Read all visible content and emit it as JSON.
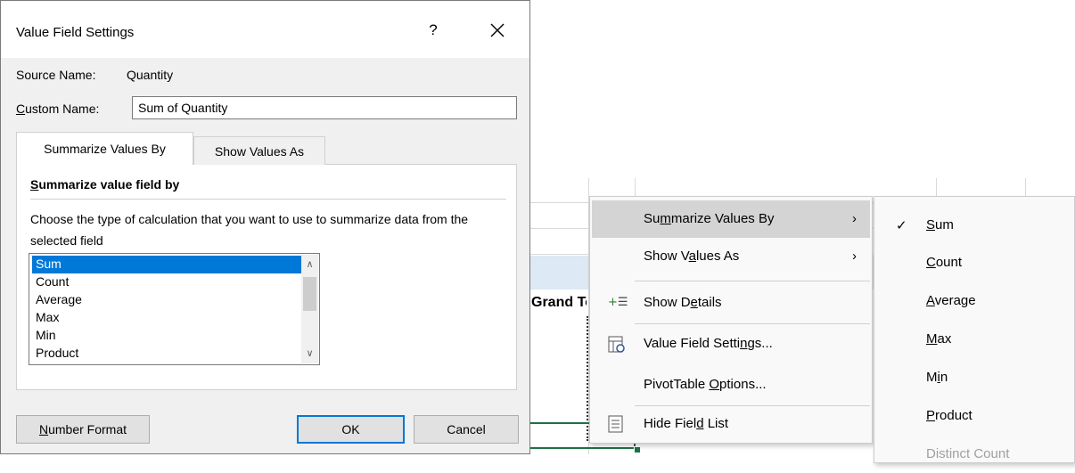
{
  "dialog": {
    "title": "Value Field Settings",
    "help_label": "?",
    "source_name_label": "Source Name:",
    "source_name_value": "Quantity",
    "custom_name_label_first": "C",
    "custom_name_label_rest": "ustom Name:",
    "custom_name_value": "Sum of Quantity",
    "tabs": [
      {
        "label": "Summarize Values By",
        "active": true
      },
      {
        "label": "Show Values As",
        "active": false
      }
    ],
    "section_title_first": "S",
    "section_title_rest": "ummarize value field by",
    "description": "Choose the type of calculation that you want to use to summarize data from the selected field",
    "list_items": [
      "Sum",
      "Count",
      "Average",
      "Max",
      "Min",
      "Product"
    ],
    "selected_item": "Sum",
    "buttons": {
      "number_format_first": "N",
      "number_format_rest": "umber Format",
      "ok": "OK",
      "cancel": "Cancel"
    }
  },
  "sheet": {
    "grand_total_cell": "Grand Total"
  },
  "context_menu": {
    "items": [
      {
        "pre": "Su",
        "acc": "m",
        "post": "marize Values By",
        "submenu": true,
        "highlighted": true
      },
      {
        "pre": "Show V",
        "acc": "a",
        "post": "lues As",
        "submenu": true
      },
      {
        "pre": "Show D",
        "acc": "e",
        "post": "tails",
        "icon": "show-details-icon"
      },
      {
        "pre": "Value Field Setti",
        "acc": "n",
        "post": "gs...",
        "icon": "value-field-settings-icon"
      },
      {
        "pre": "PivotTable ",
        "acc": "O",
        "post": "ptions..."
      },
      {
        "pre": "Hide Fiel",
        "acc": "d",
        "post": " List",
        "icon": "hide-field-list-icon"
      }
    ]
  },
  "submenu": {
    "items": [
      {
        "pre": "",
        "acc": "S",
        "post": "um",
        "checked": true
      },
      {
        "pre": "",
        "acc": "C",
        "post": "ount"
      },
      {
        "pre": "",
        "acc": "A",
        "post": "verage"
      },
      {
        "pre": "",
        "acc": "M",
        "post": "ax"
      },
      {
        "pre": "M",
        "acc": "i",
        "post": "n"
      },
      {
        "pre": "",
        "acc": "P",
        "post": "roduct"
      },
      {
        "pre": "Distinct Count",
        "acc": "",
        "post": "",
        "disabled": true
      }
    ]
  }
}
